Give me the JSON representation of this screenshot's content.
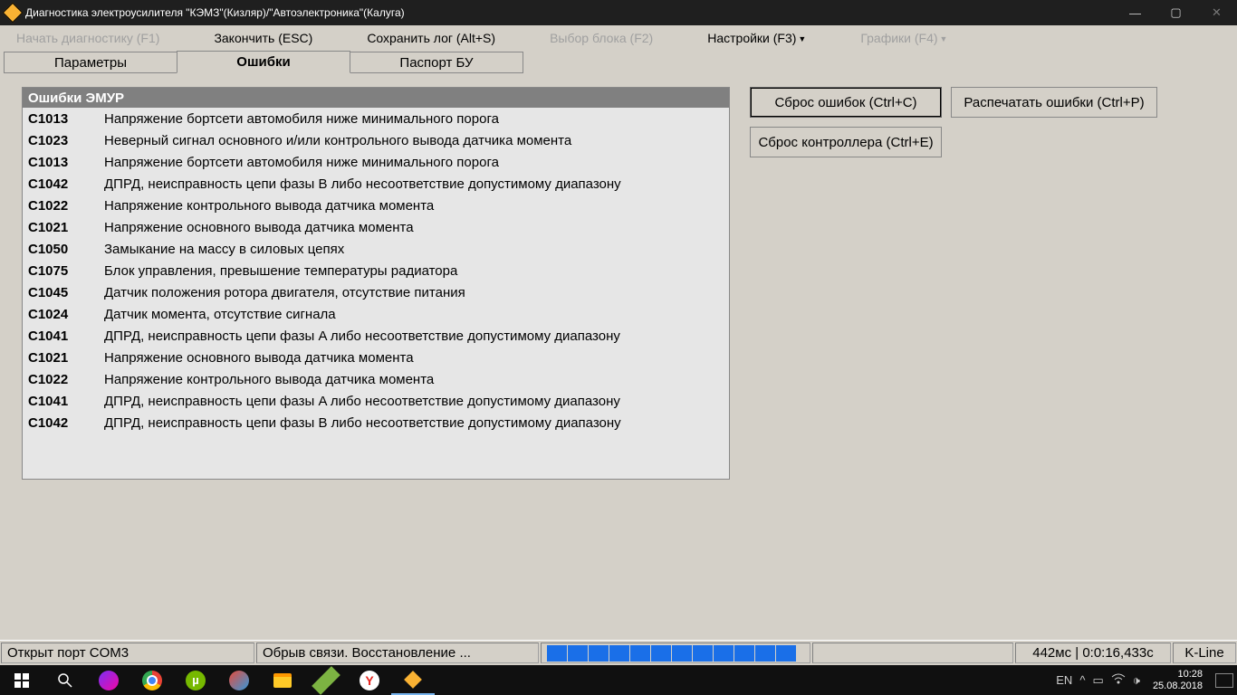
{
  "window": {
    "title": "Диагностика электроусилителя \"КЭМЗ\"(Кизляр)/\"Автоэлектроника\"(Калуга)"
  },
  "menu": {
    "start": "Начать диагностику (F1)",
    "finish": "Закончить (ESC)",
    "savelog": "Сохранить лог (Alt+S)",
    "block": "Выбор блока (F2)",
    "settings": "Настройки (F3)",
    "charts": "Графики (F4)"
  },
  "tabs": {
    "params": "Параметры",
    "errors": "Ошибки",
    "passport": "Паспорт БУ"
  },
  "errors": {
    "title": "Ошибки ЭМУР",
    "rows": [
      {
        "code": "C1013",
        "desc": "Напряжение бортсети автомобиля ниже минимального порога"
      },
      {
        "code": "C1023",
        "desc": "Неверный сигнал основного и/или контрольного вывода датчика момента"
      },
      {
        "code": "C1013",
        "desc": "Напряжение бортсети автомобиля ниже минимального порога"
      },
      {
        "code": "C1042",
        "desc": "ДПРД, неисправность цепи фазы B либо несоответствие допустимому диапазону"
      },
      {
        "code": "C1022",
        "desc": "Напряжение контрольного вывода датчика момента"
      },
      {
        "code": "C1021",
        "desc": "Напряжение основного вывода датчика момента"
      },
      {
        "code": "C1050",
        "desc": "Замыкание на массу в силовых цепях"
      },
      {
        "code": "C1075",
        "desc": "Блок управления, превышение температуры радиатора"
      },
      {
        "code": "C1045",
        "desc": "Датчик положения ротора двигателя, отсутствие питания"
      },
      {
        "code": "C1024",
        "desc": "Датчик момента, отсутствие сигнала"
      },
      {
        "code": "C1041",
        "desc": "ДПРД, неисправность цепи фазы A либо несоответствие допустимому диапазону"
      },
      {
        "code": "C1021",
        "desc": "Напряжение основного вывода датчика момента"
      },
      {
        "code": "C1022",
        "desc": "Напряжение контрольного вывода датчика момента"
      },
      {
        "code": "C1041",
        "desc": "ДПРД, неисправность цепи фазы A либо несоответствие допустимому диапазону"
      },
      {
        "code": "C1042",
        "desc": "ДПРД, неисправность цепи фазы B либо несоответствие допустимому диапазону"
      }
    ]
  },
  "buttons": {
    "clear_errors": "Сброс ошибок (Ctrl+C)",
    "print_errors": "Распечатать ошибки (Ctrl+P)",
    "clear_controller": "Сброс контроллера (Ctrl+E)"
  },
  "status": {
    "port": "Открыт порт COM3",
    "conn": "Обрыв связи. Восстановление ...",
    "timing": "442мс | 0:0:16,433с",
    "proto": "K-Line"
  },
  "tray": {
    "lang": "EN",
    "time": "10:28",
    "date": "25.08.2018"
  }
}
